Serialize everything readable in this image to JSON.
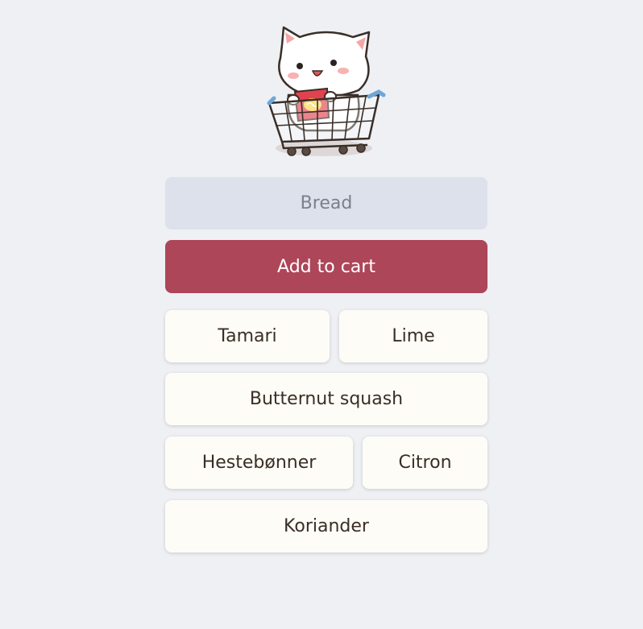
{
  "mascot": {
    "icon": "cat-in-shopping-cart-icon"
  },
  "search": {
    "placeholder": "Bread",
    "value": ""
  },
  "actions": {
    "add_label": "Add to cart",
    "add_color": "#ad4659"
  },
  "suggestions": {
    "items": [
      {
        "label": "Tamari"
      },
      {
        "label": "Lime"
      },
      {
        "label": "Butternut squash"
      },
      {
        "label": "Hestebønner"
      },
      {
        "label": "Citron"
      },
      {
        "label": "Koriander"
      }
    ]
  },
  "colors": {
    "background": "#eef0f4",
    "input_bg": "#dde1ec",
    "chip_bg": "#fdfcf7",
    "chip_text": "#3a2e24"
  }
}
